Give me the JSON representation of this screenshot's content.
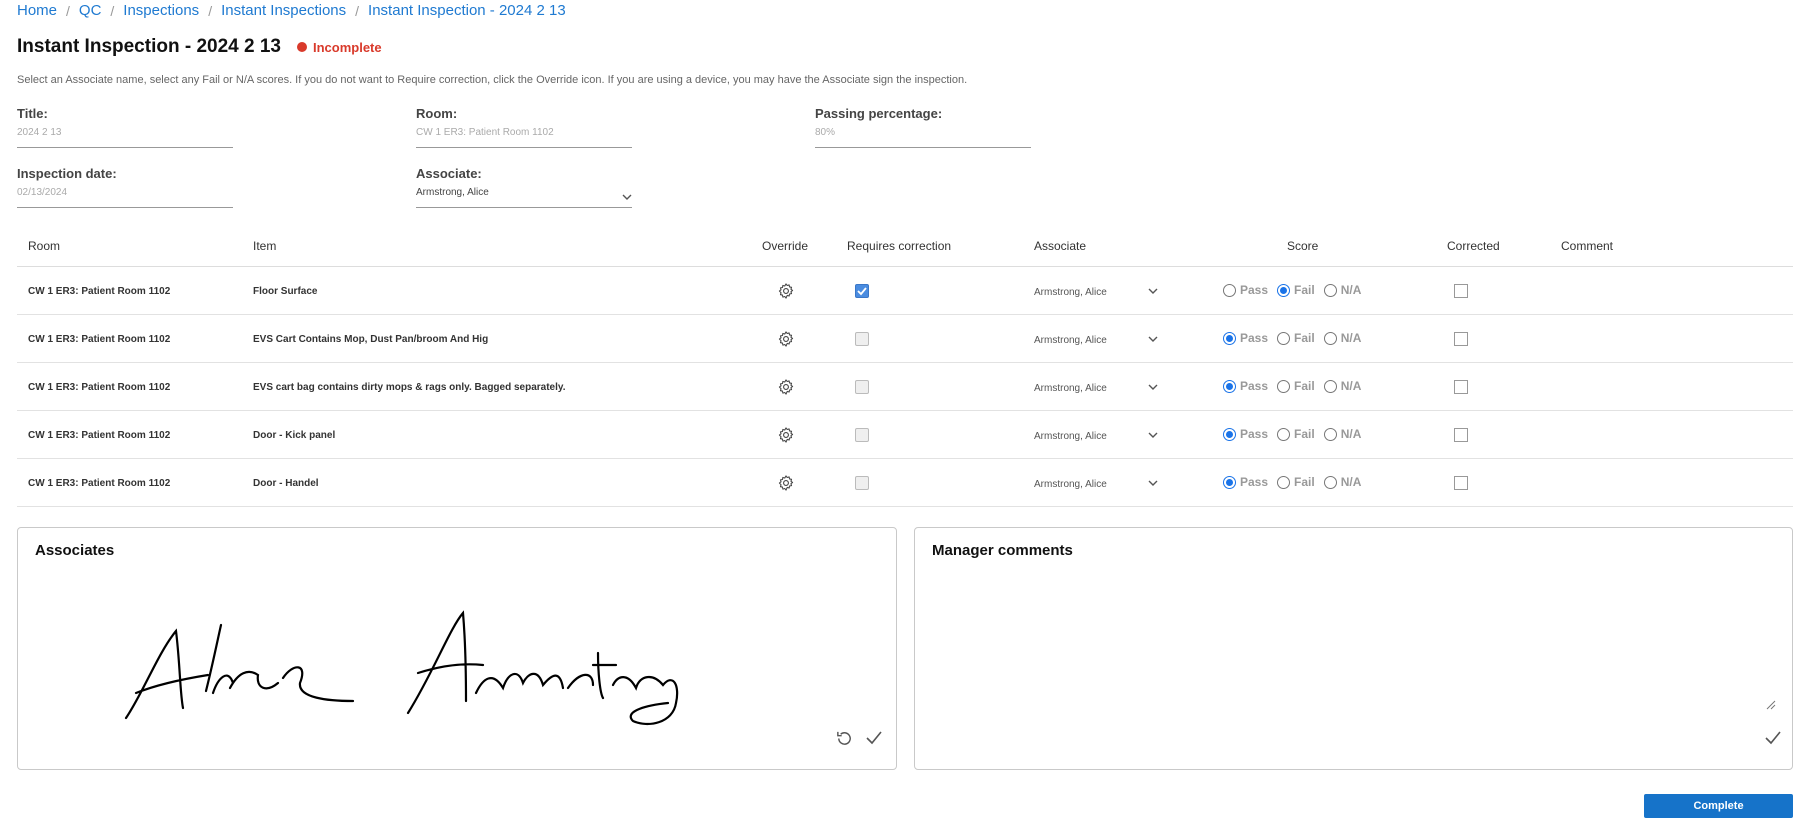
{
  "breadcrumb": [
    "Home",
    "QC",
    "Inspections",
    "Instant Inspections",
    "Instant Inspection - 2024 2 13"
  ],
  "page": {
    "title": "Instant Inspection - 2024 2 13",
    "status": "Incomplete",
    "instructions": "Select an Associate name, select any Fail or N/A scores. If you do not want to Require correction, click the Override icon. If you are using a device, you may have the Associate sign the inspection."
  },
  "form": {
    "title_label": "Title:",
    "title_value": "2024 2 13",
    "room_label": "Room:",
    "room_value": "CW 1 ER3: Patient Room 1102",
    "passing_label": "Passing percentage:",
    "passing_value": "80%",
    "date_label": "Inspection date:",
    "date_value": "02/13/2024",
    "associate_label": "Associate:",
    "associate_value": "Armstrong, Alice"
  },
  "table": {
    "headers": {
      "room": "Room",
      "item": "Item",
      "override": "Override",
      "requires": "Requires correction",
      "associate": "Associate",
      "score": "Score",
      "corrected": "Corrected",
      "comment": "Comment"
    },
    "score_labels": {
      "pass": "Pass",
      "fail": "Fail",
      "na": "N/A"
    },
    "rows": [
      {
        "room": "CW 1 ER3: Patient Room 1102",
        "item": "Floor Surface",
        "requires": true,
        "associate": "Armstrong, Alice",
        "score": "fail",
        "corrected": false
      },
      {
        "room": "CW 1 ER3: Patient Room 1102",
        "item": "EVS Cart Contains Mop, Dust Pan/broom And Hig",
        "requires": false,
        "associate": "Armstrong, Alice",
        "score": "pass",
        "corrected": false
      },
      {
        "room": "CW 1 ER3: Patient Room 1102",
        "item": "EVS cart bag contains dirty mops & rags only. Bagged separately.",
        "requires": false,
        "associate": "Armstrong, Alice",
        "score": "pass",
        "corrected": false
      },
      {
        "room": "CW 1 ER3: Patient Room 1102",
        "item": "Door - Kick panel",
        "requires": false,
        "associate": "Armstrong, Alice",
        "score": "pass",
        "corrected": false
      },
      {
        "room": "CW 1 ER3: Patient Room 1102",
        "item": "Door - Handel",
        "requires": false,
        "associate": "Armstrong, Alice",
        "score": "pass",
        "corrected": false
      }
    ]
  },
  "associates_panel": {
    "title": "Associates",
    "signature": "Alice Armstrong"
  },
  "manager_panel": {
    "title": "Manager comments"
  },
  "complete_button": "Complete",
  "colors": {
    "accent": "#1673c9",
    "link": "#1f7ad1",
    "status": "#d93a2b",
    "radio": "#1a73e8",
    "checkbox": "#4a8ce0"
  }
}
